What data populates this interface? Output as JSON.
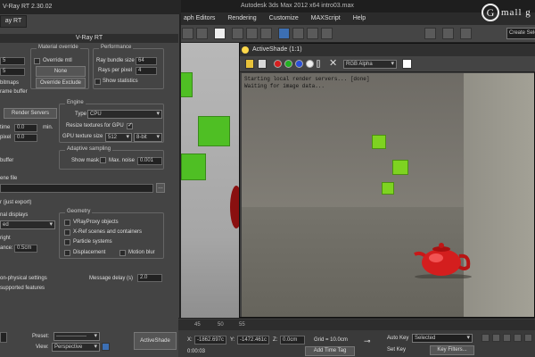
{
  "max": {
    "title": "Autodesk 3ds Max 2012 x64    intro03.max",
    "menu": [
      "aph Editors",
      "Rendering",
      "Customize",
      "MAXScript",
      "Help"
    ],
    "selection_set_placeholder": "Create Selection Se"
  },
  "watermark": {
    "glyph": "G",
    "text": "mall g"
  },
  "vray": {
    "title": "V-Ray RT 2.30.02",
    "tab": "ay RT",
    "header": "V-Ray RT",
    "material_override": {
      "title": "Material override",
      "override_label": "Override mtl",
      "none_label": "None",
      "exclude_label": "Override Exclude"
    },
    "performance": {
      "title": "Performance",
      "ray_bundle_label": "Ray bundle size",
      "ray_bundle_value": "64",
      "rays_per_pixel_label": "Rays per pixel",
      "rays_per_pixel_value": "4",
      "show_stats_label": "Show statistics"
    },
    "left_partial": {
      "bitmaps": "bitmaps",
      "frame_buffer": "rame buffer",
      "val1": "5",
      "val2": "5",
      "time_label": "time",
      "time_value": "0.0",
      "min_label": "min.",
      "pixel_label": "pixel",
      "pixel_value": "0.0",
      "buffer_label": "buffer"
    },
    "render_servers": "Render Servers",
    "engine": {
      "title": "Engine",
      "type_label": "Type",
      "type_value": "CPU",
      "resize_label": "Resize textures for GPU",
      "gpu_tex_label": "GPU texture size",
      "gpu_tex_value": "512",
      "bit_value": "8-bit"
    },
    "adaptive": {
      "title": "Adaptive sampling",
      "show_mask_label": "Show mask",
      "max_noise_label": "Max. noise",
      "max_noise_value": "0.001"
    },
    "scene_file": {
      "label": "ene file",
      "export_label": "r (just export)"
    },
    "geometry": {
      "title": "Geometry",
      "items": [
        "VRayProxy objects",
        "X-Ref scenes and containers",
        "Particle systems"
      ],
      "displacement_label": "Displacement",
      "motion_blur_label": "Motion blur"
    },
    "displays": {
      "title": "nal displays",
      "select_value": "ed",
      "right_label": "right",
      "dist_label": "ance:",
      "dist_value": "0.5cm"
    },
    "physical_label": "on-physical settings",
    "supported_label": "supported features",
    "message_delay_label": "Message delay (s)",
    "message_delay_value": "2.0",
    "preset_label": "Preset:",
    "preset_value": "-----------------",
    "view_label": "View:",
    "view_value": "Perspective",
    "activeshade_button": "ActiveShade"
  },
  "activeshade": {
    "title": "ActiveShade (1:1)",
    "channel_value": "RGB Alpha",
    "log_lines": [
      "Starting local render servers... [done]",
      "Waiting for image data..."
    ]
  },
  "bottom": {
    "ticks": [
      "45",
      "50",
      "55"
    ],
    "x_label": "X:",
    "x_value": "-1862.697c",
    "y_label": "Y:",
    "y_value": "-1472.461c",
    "z_label": "Z:",
    "z_value": "0.0cm",
    "grid_label": "Grid = 10.0cm",
    "add_time_tag": "Add Time Tag",
    "auto_key": "Auto Key",
    "set_key": "Set Key",
    "selected_value": "Selected",
    "key_filters": "Key Filters...",
    "time_readout": "0:00:03"
  },
  "colors": {
    "accent_red": "#d72020",
    "cube_green": "#7ed321"
  }
}
